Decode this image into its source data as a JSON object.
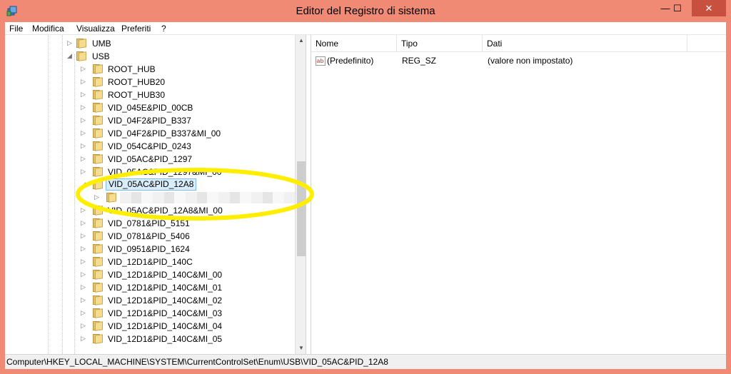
{
  "window": {
    "title": "Editor del Registro di sistema",
    "minimize_glyph": "—",
    "maximize_glyph": "☐",
    "close_glyph": "✕"
  },
  "menu": [
    "File",
    "Modifica",
    "Visualizza",
    "Preferiti",
    "?"
  ],
  "tree": {
    "parents": [
      {
        "label": "UMB",
        "expanded": false
      },
      {
        "label": "USB",
        "expanded": true
      }
    ],
    "children": [
      "ROOT_HUB",
      "ROOT_HUB20",
      "ROOT_HUB30",
      "VID_045E&PID_00CB",
      "VID_04F2&PID_B337",
      "VID_04F2&PID_B337&MI_00",
      "VID_054C&PID_0243",
      "VID_05AC&PID_1297",
      "VID_05AC&PID_1297&MI_00",
      "VID_05AC&PID_12A8",
      "",
      "VID_05AC&PID_12A8&MI_00",
      "VID_0781&PID_5151",
      "VID_0781&PID_5406",
      "VID_0951&PID_1624",
      "VID_12D1&PID_140C",
      "VID_12D1&PID_140C&MI_00",
      "VID_12D1&PID_140C&MI_01",
      "VID_12D1&PID_140C&MI_02",
      "VID_12D1&PID_140C&MI_03",
      "VID_12D1&PID_140C&MI_04",
      "VID_12D1&PID_140C&MI_05"
    ],
    "selected_index": 9,
    "subkey_index": 10
  },
  "list": {
    "columns": [
      "Nome",
      "Tipo",
      "Dati"
    ],
    "rows": [
      {
        "name": "(Predefinito)",
        "type": "REG_SZ",
        "data": "(valore non impostato)",
        "icon": "string-value-icon",
        "icon_text": "ab"
      }
    ]
  },
  "status": {
    "path": "Computer\\HKEY_LOCAL_MACHINE\\SYSTEM\\CurrentControlSet\\Enum\\USB\\VID_05AC&PID_12A8"
  },
  "colors": {
    "titlebar": "#f08a75",
    "close_button": "#c7503f",
    "annotation": "#ffee00",
    "selection": "#d9ecfa"
  }
}
